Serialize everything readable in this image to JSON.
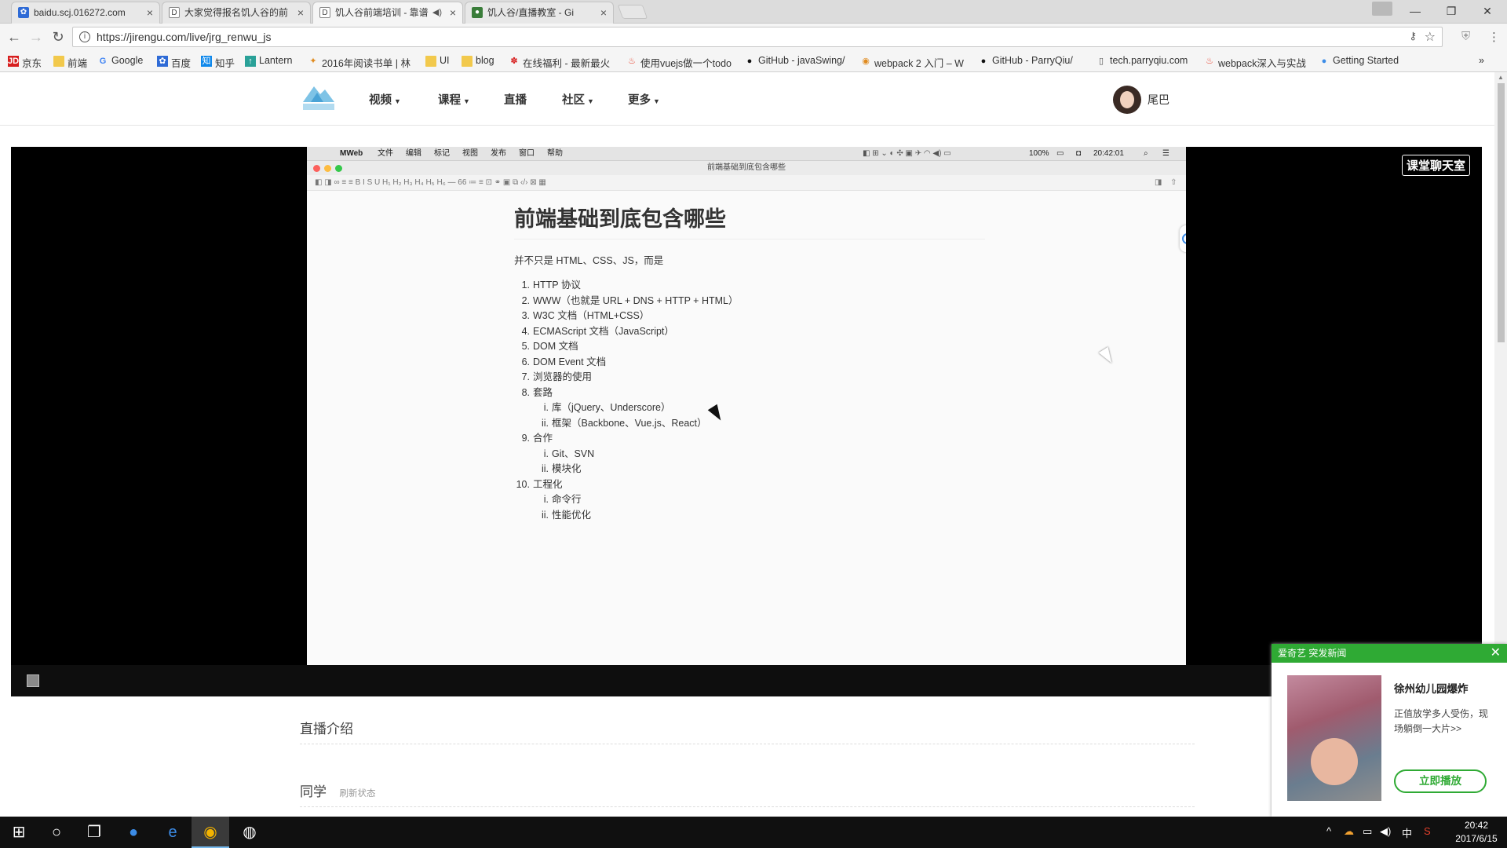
{
  "browser": {
    "tabs": [
      {
        "title": "baidu.scj.016272.com",
        "icon": "paw-icon",
        "icon_color": "#2f6bd6",
        "active": false
      },
      {
        "title": "大家觉得报名饥人谷的前",
        "icon": "d-icon",
        "icon_color": "#555555",
        "active": false
      },
      {
        "title": "饥人谷前端培训 - 靠谱",
        "icon": "d-icon",
        "icon_color": "#555555",
        "active": true
      },
      {
        "title": "饥人谷/直播教室 - Gi",
        "icon": "git-icon",
        "icon_color": "#3a7d3a",
        "active": false
      }
    ],
    "url": "https://jirengu.com/live/jrg_renwu_js",
    "bookmarks": [
      {
        "label": "京东",
        "icon": "jd-icon"
      },
      {
        "label": "前端",
        "icon": "folder-icon"
      },
      {
        "label": "Google",
        "icon": "google-icon"
      },
      {
        "label": "百度",
        "icon": "baidu-icon"
      },
      {
        "label": "知乎",
        "icon": "zhihu-icon"
      },
      {
        "label": "Lantern",
        "icon": "lantern-icon"
      },
      {
        "label": "2016年阅读书单 | 林",
        "icon": "book-icon"
      },
      {
        "label": "UI",
        "icon": "folder-icon"
      },
      {
        "label": "blog",
        "icon": "folder-icon"
      },
      {
        "label": "在线福利 - 最新最火",
        "icon": "gift-icon"
      },
      {
        "label": "使用vuejs做一个todo",
        "icon": "flame-icon"
      },
      {
        "label": "GitHub - javaSwing/",
        "icon": "github-icon"
      },
      {
        "label": "webpack 2 入门 – W",
        "icon": "webpack-icon"
      },
      {
        "label": "GitHub - ParryQiu/",
        "icon": "github-icon"
      },
      {
        "label": "tech.parryqiu.com",
        "icon": "page-icon"
      },
      {
        "label": "webpack深入与实战",
        "icon": "flame-icon"
      },
      {
        "label": "Getting Started",
        "icon": "globe-icon"
      }
    ]
  },
  "site": {
    "nav": [
      {
        "label": "视频",
        "caret": true
      },
      {
        "label": "课程",
        "caret": true
      },
      {
        "label": "直播",
        "caret": false
      },
      {
        "label": "社区",
        "caret": true
      },
      {
        "label": "更多",
        "caret": true
      }
    ],
    "username": "尾巴",
    "chat_button": "课堂聊天室",
    "section_intro": "直播介绍",
    "section_classmates": "同学",
    "refresh_status": "刷新状态"
  },
  "stream": {
    "mac_menu": [
      "MWeb",
      "文件",
      "编辑",
      "标记",
      "视图",
      "发布",
      "窗口",
      "帮助"
    ],
    "mac_status": {
      "battery": "100%",
      "time": "20:42:01"
    },
    "window_title": "前端基础到底包含哪些",
    "doc": {
      "title": "前端基础到底包含哪些",
      "lead": "并不只是 HTML、CSS、JS，而是",
      "items": [
        {
          "num": "1.",
          "text": "HTTP 协议",
          "sub": false
        },
        {
          "num": "2.",
          "text": "WWW（也就是 URL + DNS + HTTP + HTML）",
          "sub": false
        },
        {
          "num": "3.",
          "text": "W3C 文档（HTML+CSS）",
          "sub": false
        },
        {
          "num": "4.",
          "text": "ECMAScript 文档（JavaScript）",
          "sub": false
        },
        {
          "num": "5.",
          "text": "DOM 文档",
          "sub": false
        },
        {
          "num": "6.",
          "text": "DOM Event 文档",
          "sub": false
        },
        {
          "num": "7.",
          "text": "浏览器的使用",
          "sub": false
        },
        {
          "num": "8.",
          "text": "套路",
          "sub": false
        },
        {
          "num": "i.",
          "text": "库（jQuery、Underscore）",
          "sub": true
        },
        {
          "num": "ii.",
          "text": "框架（Backbone、Vue.js、React）",
          "sub": true
        },
        {
          "num": "9.",
          "text": "合作",
          "sub": false
        },
        {
          "num": "i.",
          "text": "Git、SVN",
          "sub": true
        },
        {
          "num": "ii.",
          "text": "模块化",
          "sub": true
        },
        {
          "num": "10.",
          "text": "工程化",
          "sub": false
        },
        {
          "num": "i.",
          "text": "命令行",
          "sub": true
        },
        {
          "num": "ii.",
          "text": "性能优化",
          "sub": true
        }
      ]
    }
  },
  "popup": {
    "header": "爱奇艺 突发新闻",
    "title": "徐州幼儿园爆炸",
    "desc": "正值放学多人受伤，现场躺倒一大片>>",
    "button": "立即播放"
  },
  "taskbar": {
    "time": "20:42",
    "date": "2017/6/15",
    "ime": "中"
  },
  "colors": {
    "accent_green": "#2faa34",
    "tab_active": "#f5f5f5"
  }
}
